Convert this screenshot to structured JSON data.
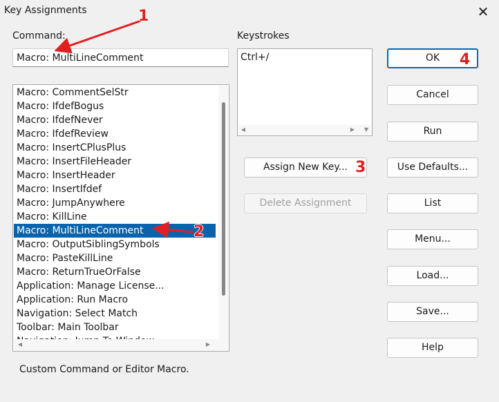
{
  "window": {
    "title": "Key Assignments",
    "close_glyph": "✕"
  },
  "command": {
    "label": "Command:",
    "value": "Macro: MultiLineComment"
  },
  "keystrokes": {
    "label": "Keystrokes",
    "items": [
      "Ctrl+/"
    ]
  },
  "command_list": {
    "items": [
      "Macro: CommentSelStr",
      "Macro: IfdefBogus",
      "Macro: IfdefNever",
      "Macro: IfdefReview",
      "Macro: InsertCPlusPlus",
      "Macro: InsertFileHeader",
      "Macro: InsertHeader",
      "Macro: InsertIfdef",
      "Macro: JumpAnywhere",
      "Macro: KillLine",
      "Macro: MultiLineComment",
      "Macro: OutputSiblingSymbols",
      "Macro: PasteKillLine",
      "Macro: ReturnTrueOrFalse",
      "Application: Manage License...",
      "Application: Run Macro",
      "Navigation: Select Match",
      "Toolbar: Main Toolbar",
      "Navigation: Jump To Window"
    ],
    "selected_index": 10
  },
  "buttons": {
    "assign_new_key": "Assign New Key...",
    "delete_assignment": "Delete Assignment",
    "ok": "OK",
    "cancel": "Cancel",
    "run": "Run",
    "use_defaults": "Use Defaults...",
    "list": "List",
    "menu": "Menu...",
    "load": "Load...",
    "save": "Save...",
    "help": "Help"
  },
  "status_text": "Custom Command or Editor Macro.",
  "annotations": {
    "n1": "1",
    "n2": "2",
    "n3": "3",
    "n4": "4",
    "color": "#e02020"
  },
  "colors": {
    "selection": "#0a64ad",
    "default_button_border": "#0067c0",
    "background": "#f0f0f0"
  }
}
